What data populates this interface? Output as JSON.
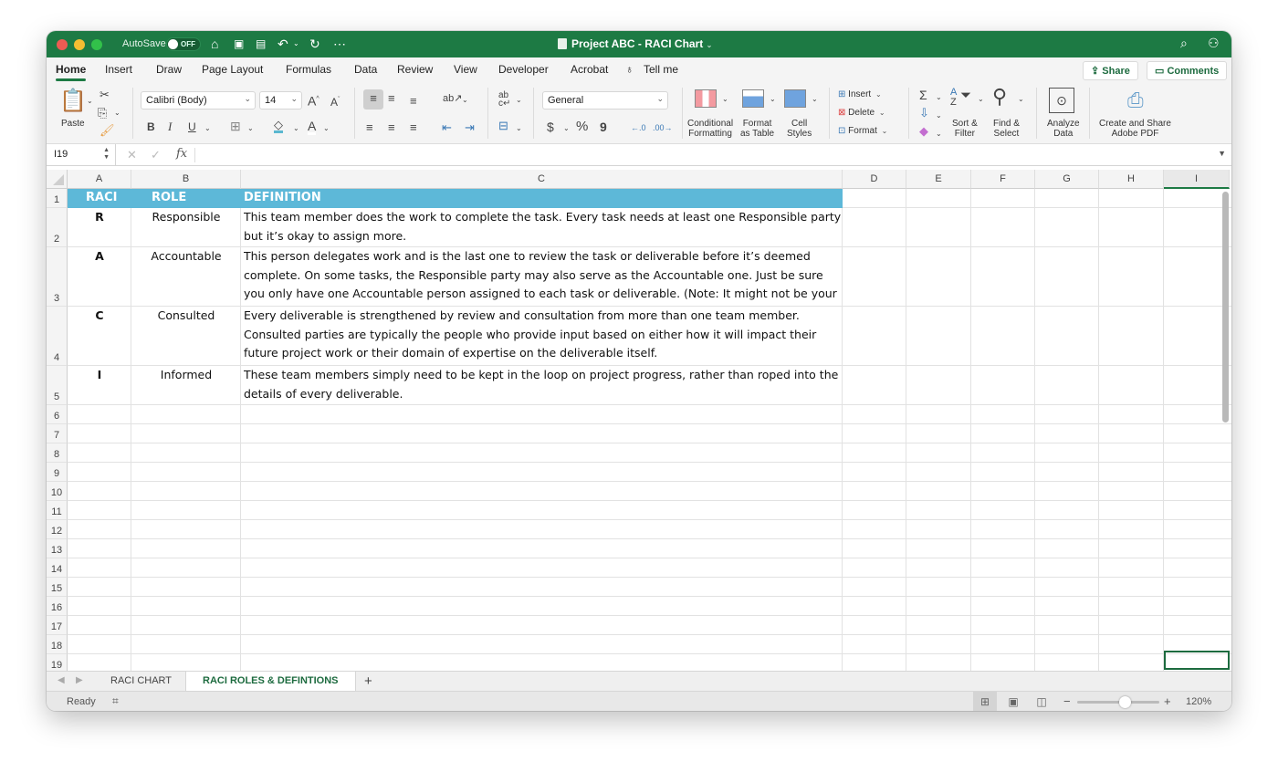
{
  "titlebar": {
    "autosave_label": "AutoSave",
    "autosave_state": "OFF",
    "document_title": "Project ABC - RACI Chart"
  },
  "menu": {
    "tabs": [
      "Home",
      "Insert",
      "Draw",
      "Page Layout",
      "Formulas",
      "Data",
      "Review",
      "View",
      "Developer",
      "Acrobat"
    ],
    "active_tab": "Home",
    "tell_me": "Tell me",
    "share": "Share",
    "comments": "Comments"
  },
  "ribbon": {
    "paste": "Paste",
    "font_name": "Calibri (Body)",
    "font_size": "14",
    "bold": "B",
    "italic": "I",
    "underline": "U",
    "number_format": "General",
    "currency": "$",
    "percent": "%",
    "comma": "9",
    "conditional_formatting": [
      "Conditional",
      "Formatting"
    ],
    "format_as_table": [
      "Format",
      "as Table"
    ],
    "cell_styles": [
      "Cell",
      "Styles"
    ],
    "insert": "Insert",
    "delete": "Delete",
    "format": "Format",
    "sort_filter": [
      "Sort &",
      "Filter"
    ],
    "find_select": [
      "Find &",
      "Select"
    ],
    "analyze_data": [
      "Analyze",
      "Data"
    ],
    "adobe_pdf": [
      "Create and Share",
      "Adobe PDF"
    ]
  },
  "formula_bar": {
    "name_box": "I19",
    "fx": "fx",
    "formula": ""
  },
  "sheet": {
    "columns": [
      "A",
      "B",
      "C",
      "D",
      "E",
      "F",
      "G",
      "H",
      "I"
    ],
    "selected_column": "I",
    "rows": [
      "1",
      "2",
      "3",
      "4",
      "5",
      "6",
      "7",
      "8",
      "9",
      "10",
      "11",
      "12",
      "13",
      "14",
      "15",
      "16",
      "17",
      "18",
      "19"
    ],
    "header": {
      "raci": "RACI",
      "role": "ROLE",
      "definition": "DEFINITION"
    },
    "header_color": "#5db8d8",
    "data": [
      {
        "raci": "R",
        "role": "Responsible",
        "definition": [
          "This team member does the work to complete the task. Every task needs at least one Responsible party,",
          "but it’s okay to assign more."
        ]
      },
      {
        "raci": "A",
        "role": "Accountable",
        "definition": [
          "This person delegates work and is the last one to review the task or deliverable before it’s deemed",
          "complete. On some tasks, the Responsible party may also serve as the Accountable one. Just be sure",
          "you only have one Accountable person assigned to each task or deliverable. (Note: It might not be your"
        ]
      },
      {
        "raci": "C",
        "role": "Consulted",
        "definition": [
          "Every deliverable is strengthened by review and consultation from more than one team member.",
          "Consulted parties are typically the people who provide input based on either how it will impact their",
          "future project work or their domain of expertise on the deliverable itself."
        ]
      },
      {
        "raci": "I",
        "role": "Informed",
        "definition": [
          "These team members simply need to be kept in the loop on project progress, rather than roped into the",
          "details of every deliverable."
        ]
      }
    ],
    "selected_cell": "I19"
  },
  "sheet_tabs": {
    "tabs": [
      "RACI CHART",
      "RACI ROLES & DEFINTIONS"
    ],
    "active": "RACI ROLES & DEFINTIONS",
    "add": "+"
  },
  "status": {
    "ready": "Ready",
    "zoom": "120%",
    "zoom_value": 120
  },
  "colors": {
    "brand": "#1d7a44",
    "header_fill": "#5db8d8"
  }
}
